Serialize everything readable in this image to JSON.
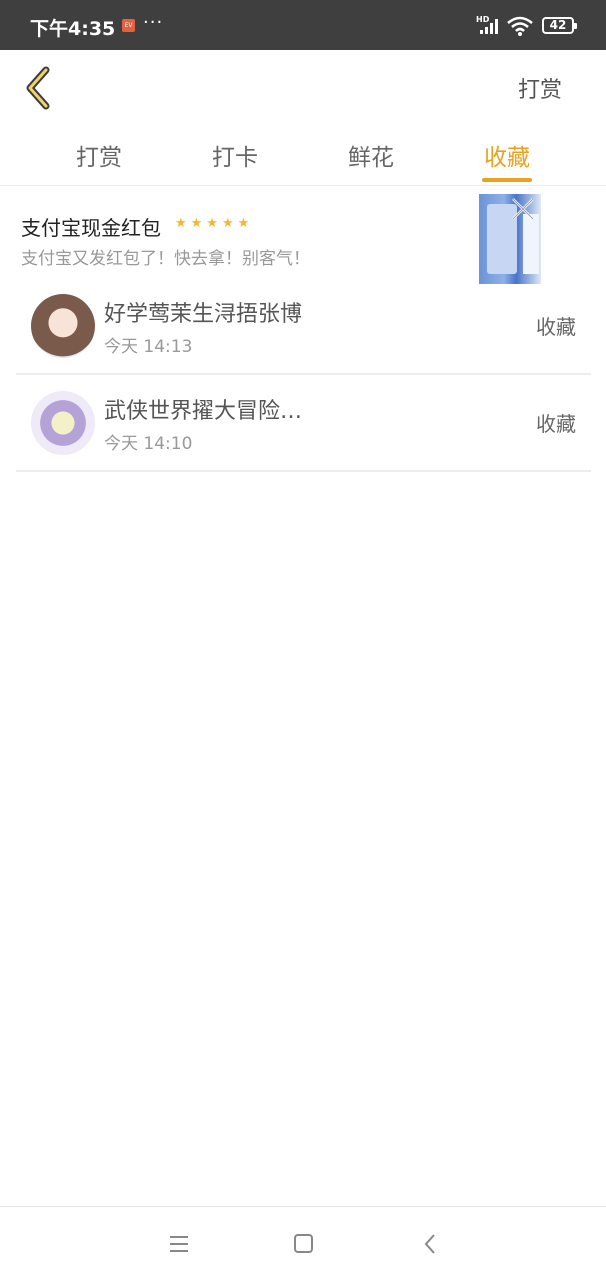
{
  "status_bar": {
    "time": "下午4:35",
    "dots": "···",
    "network": "HD",
    "battery": "42"
  },
  "header": {
    "back_icon": "chevron-left-icon",
    "right_button": "打赏",
    "accent_color": "#e8a221"
  },
  "tabs": [
    {
      "label": "打赏",
      "active": false
    },
    {
      "label": "打卡",
      "active": false
    },
    {
      "label": "鲜花",
      "active": false
    },
    {
      "label": "收藏",
      "active": true
    }
  ],
  "ad": {
    "title": "支付宝现金红包",
    "stars": "★★★★★",
    "subtitle": "支付宝又发红包了！快去拿！别客气！",
    "close_icon": "close-icon"
  },
  "list": {
    "items": [
      {
        "name": "好学莺茉生浔捂张博",
        "time": "今天 14:13",
        "action": "收藏"
      },
      {
        "name": "武侠世界擢大冒险…",
        "time": "今天 14:10",
        "action": "收藏"
      }
    ]
  },
  "bottom_nav": {
    "icons": [
      "menu-icon",
      "home-icon",
      "back-icon"
    ]
  }
}
